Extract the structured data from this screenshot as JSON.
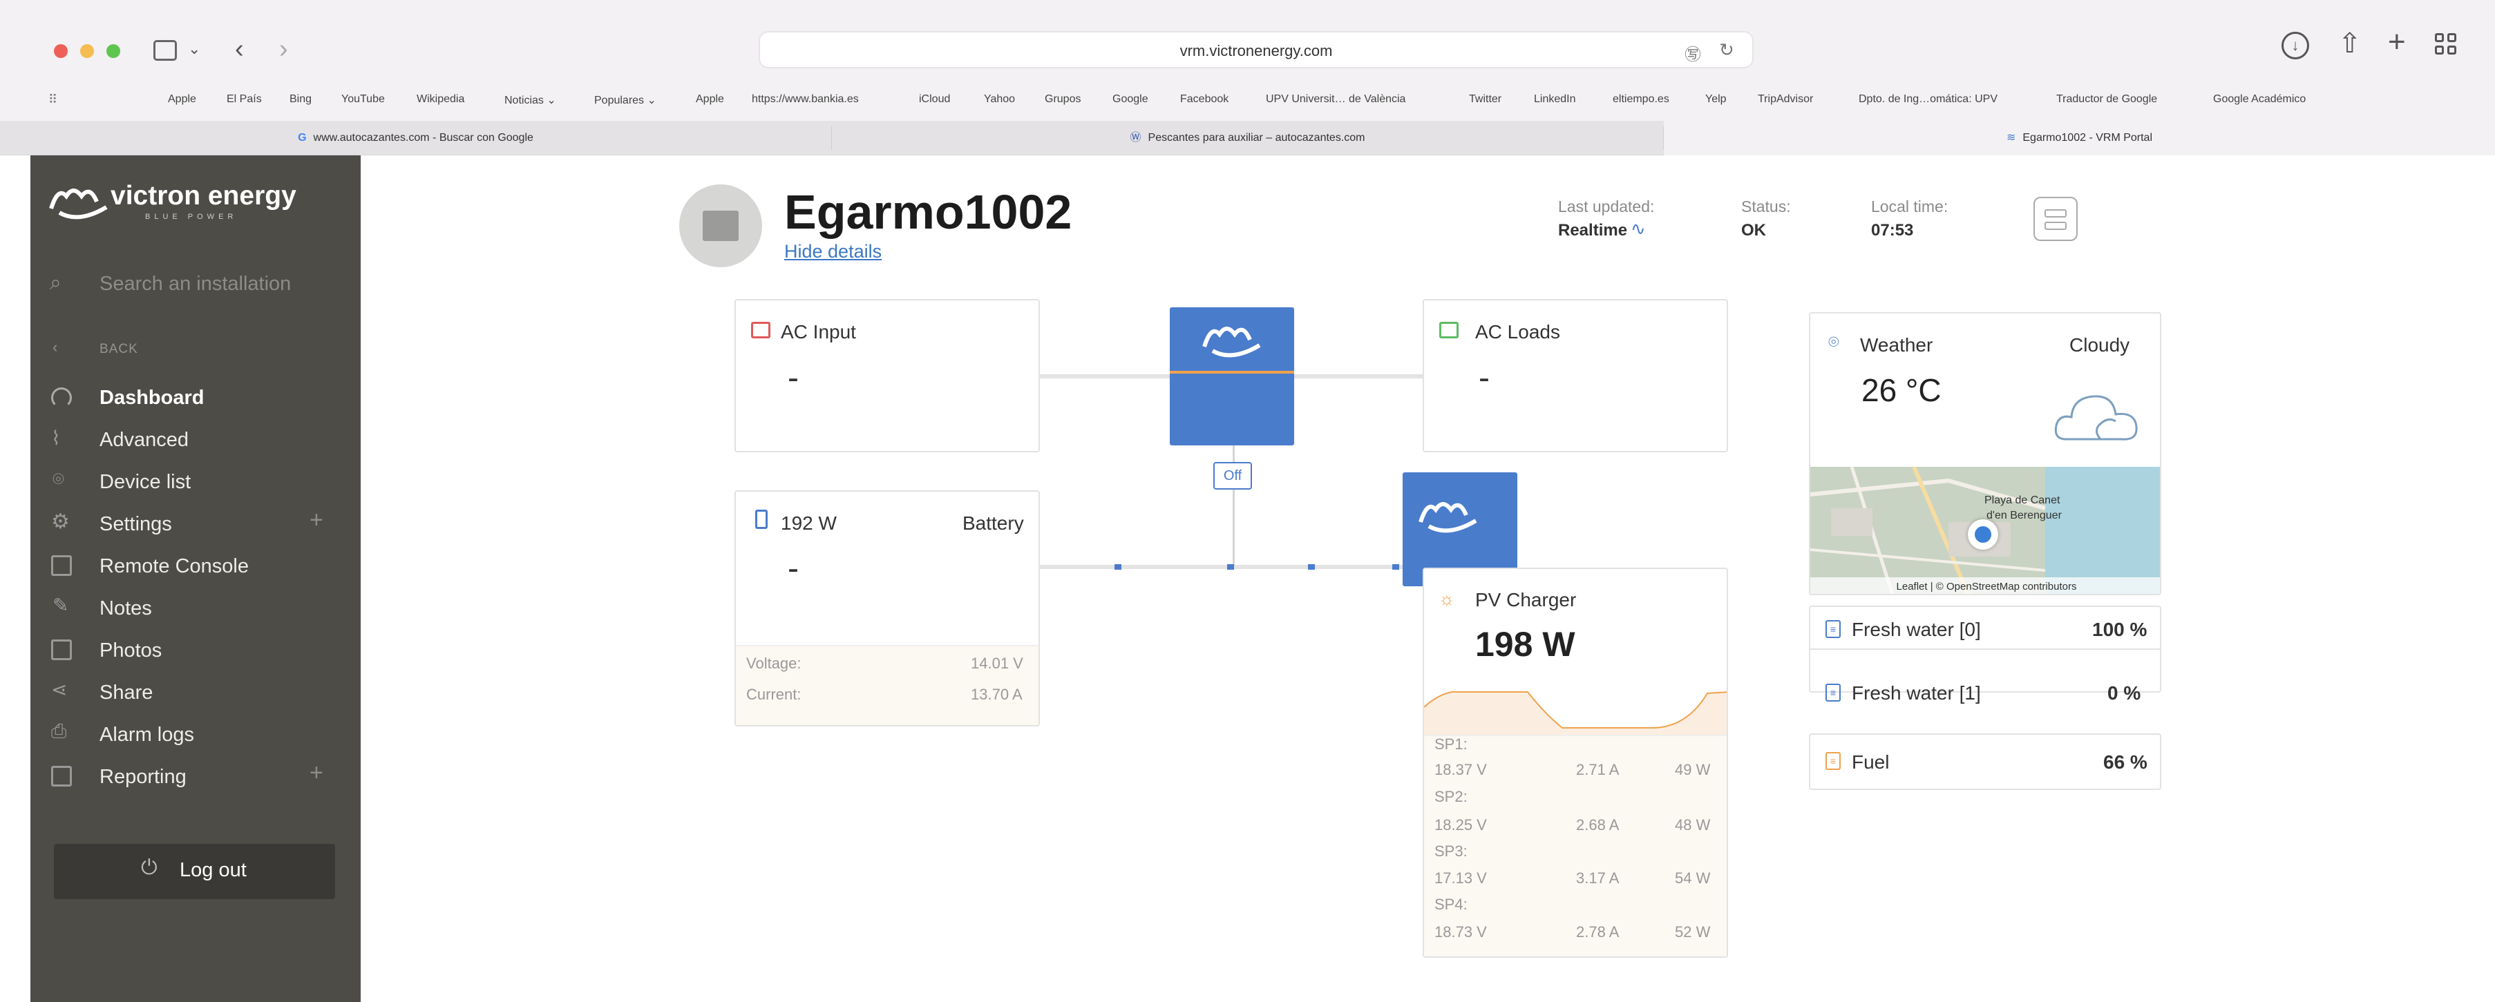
{
  "browser": {
    "url": "vrm.victronenergy.com",
    "bookmarks": [
      "Apple",
      "El País",
      "Bing",
      "YouTube",
      "Wikipedia",
      "Noticias ⌄",
      "Populares ⌄",
      "Apple",
      "https://www.bankia.es",
      "iCloud",
      "Yahoo",
      "Grupos",
      "Google",
      "Facebook",
      "UPV Universit… de València",
      "Twitter",
      "LinkedIn",
      "eltiempo.es",
      "Yelp",
      "TripAdvisor",
      "Dpto. de Ing…omática: UPV",
      "Traductor de Google",
      "Google Académico"
    ],
    "tabs": [
      {
        "label": "www.autocazantes.com - Buscar con Google"
      },
      {
        "label": "Pescantes para auxiliar – autocazantes.com"
      },
      {
        "label": "Egarmo1002 - VRM Portal"
      }
    ]
  },
  "sidebar": {
    "logo": "victron energy",
    "logo_sub": "BLUE POWER",
    "search_placeholder": "Search an installation",
    "back": "BACK",
    "items": [
      {
        "label": "Dashboard",
        "icon": "gauge-icon",
        "active": true
      },
      {
        "label": "Advanced",
        "icon": "graph-icon"
      },
      {
        "label": "Device list",
        "icon": "location-icon"
      },
      {
        "label": "Settings",
        "icon": "gear-icon",
        "plus": "+"
      },
      {
        "label": "Remote Console",
        "icon": "console-icon"
      },
      {
        "label": "Notes",
        "icon": "edit-icon"
      },
      {
        "label": "Photos",
        "icon": "photo-icon"
      },
      {
        "label": "Share",
        "icon": "share-icon"
      },
      {
        "label": "Alarm logs",
        "icon": "alarm-log-icon"
      },
      {
        "label": "Reporting",
        "icon": "report-icon",
        "plus": "+"
      }
    ],
    "logout": "Log out"
  },
  "header": {
    "title": "Egarmo1002",
    "hide_details": "Hide details",
    "last_updated_label": "Last updated:",
    "last_updated_value": "Realtime",
    "status_label": "Status:",
    "status_value": "OK",
    "local_time_label": "Local time:",
    "local_time_value": "07:53"
  },
  "ac_input": {
    "title": "AC Input",
    "value": "-"
  },
  "ac_loads": {
    "title": "AC Loads",
    "value": "-"
  },
  "inverter": {
    "state": "Off"
  },
  "battery": {
    "power": "192 W",
    "title": "Battery",
    "value": "-",
    "voltage_label": "Voltage:",
    "voltage_value": "14.01 V",
    "current_label": "Current:",
    "current_value": "13.70 A"
  },
  "pv": {
    "title": "PV Charger",
    "value": "198 W",
    "strings": [
      {
        "name": "SP1:",
        "voltage": "18.37 V",
        "current": "2.71 A",
        "power": "49 W"
      },
      {
        "name": "SP2:",
        "voltage": "18.25 V",
        "current": "2.68 A",
        "power": "48 W"
      },
      {
        "name": "SP3:",
        "voltage": "17.13 V",
        "current": "3.17 A",
        "power": "54 W"
      },
      {
        "name": "SP4:",
        "voltage": "18.73 V",
        "current": "2.78 A",
        "power": "52 W"
      }
    ]
  },
  "weather": {
    "title": "Weather",
    "condition": "Cloudy",
    "temperature": "26 °C",
    "map_label_1": "Playa de Canet",
    "map_label_2": "d'en Berenguer",
    "attribution": "Leaflet | © OpenStreetMap contributors"
  },
  "tanks": [
    {
      "name": "Fresh water [0]",
      "value": "100 %"
    },
    {
      "name": "Fresh water [1]",
      "value": "0 %"
    },
    {
      "name": "Fuel",
      "value": "66 %"
    }
  ],
  "colors": {
    "accent": "#4a7ccc",
    "sidebar": "#4d4c47",
    "link": "#3b78c3"
  }
}
